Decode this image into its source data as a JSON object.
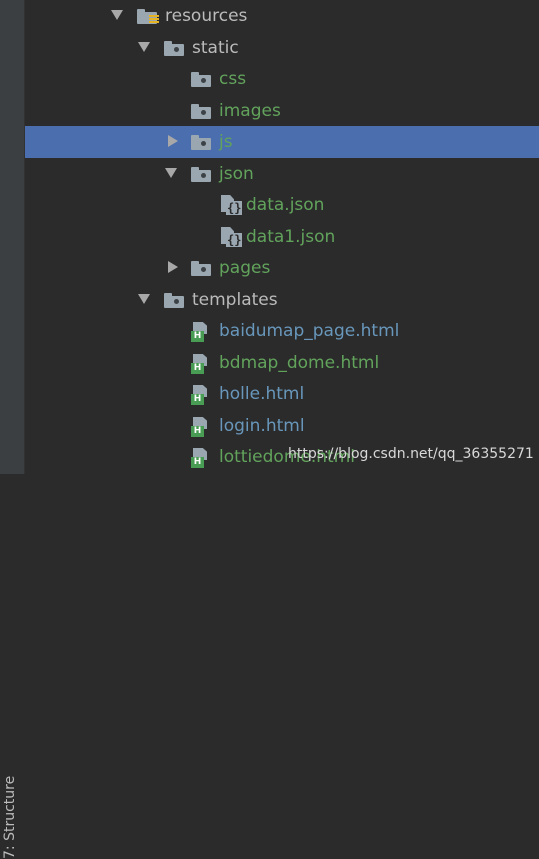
{
  "side_panel": {
    "structure_label": "7: Structure"
  },
  "tree": {
    "resources": "resources",
    "static": "static",
    "css": "css",
    "images": "images",
    "js": "js",
    "json": "json",
    "data_json": "data.json",
    "data1_json": "data1.json",
    "pages": "pages",
    "templates": "templates",
    "baidumap_page": "baidumap_page.html",
    "bdmap_dome": "bdmap_dome.html",
    "holle": "holle.html",
    "login": "login.html",
    "lottiedome": "lottiedome.html"
  },
  "watermark": "https://blog.csdn.net/qq_36355271",
  "colors": {
    "background": "#2b2b2b",
    "selection": "#4b6eaf",
    "folder_text": "#bbbbbb",
    "resource_text_green": "#62a35c",
    "html_text_blue": "#6897bb"
  }
}
